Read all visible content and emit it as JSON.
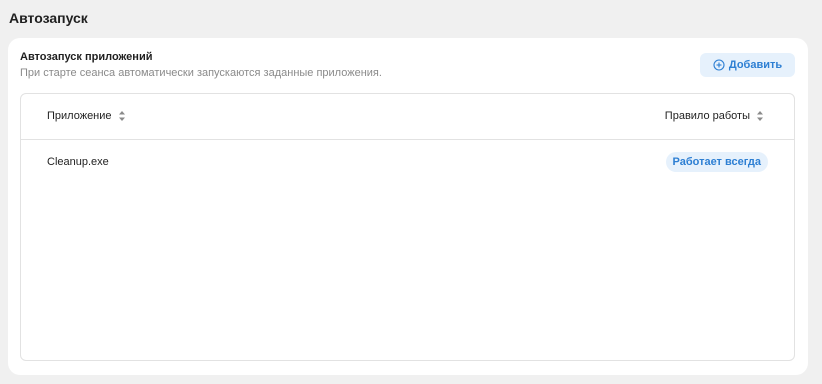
{
  "page": {
    "title": "Автозапуск"
  },
  "card": {
    "title": "Автозапуск приложений",
    "subtitle": "При старте сеанса автоматически запускаются заданные приложения.",
    "add_button_label": "Добавить",
    "add_icon": "plus-circle-icon"
  },
  "table": {
    "columns": [
      {
        "label": "Приложение",
        "sort_icon": "sort-icon"
      },
      {
        "label": "Правило работы",
        "sort_icon": "sort-icon"
      }
    ],
    "rows": [
      {
        "app": "Cleanup.exe",
        "rule": "Работает всегда"
      }
    ]
  },
  "colors": {
    "accent": "#2d7fd3",
    "accent_bg": "#e6f1fc",
    "background": "#f0f0f0",
    "card": "#ffffff",
    "border": "#e2e2e2",
    "muted_text": "#8a8a8a"
  }
}
